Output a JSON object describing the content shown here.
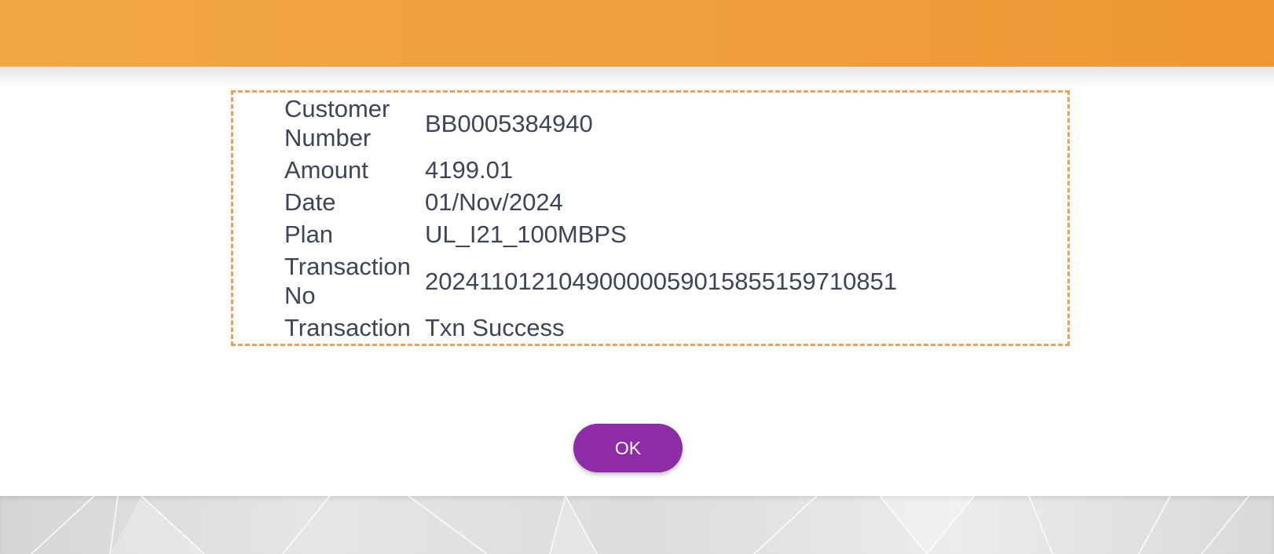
{
  "transaction_details": {
    "rows": [
      {
        "label": "Customer Number",
        "value": "BB0005384940"
      },
      {
        "label": "Amount",
        "value": "4199.01"
      },
      {
        "label": "Date",
        "value": "01/Nov/2024"
      },
      {
        "label": "Plan",
        "value": "UL_I21_100MBPS"
      },
      {
        "label": "Transaction No",
        "value": "20241101210490000059015855159710851"
      },
      {
        "label": "Transaction",
        "value": "Txn Success"
      }
    ]
  },
  "actions": {
    "ok_label": "OK"
  },
  "colors": {
    "banner": "#f0a03e",
    "box_border": "#ec9f57",
    "ok_button": "#8d2ba8",
    "text": "#3d4556"
  }
}
